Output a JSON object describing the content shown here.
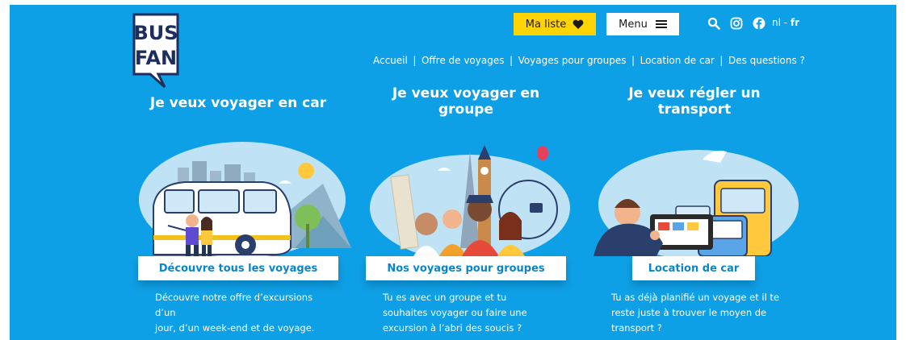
{
  "logo": {
    "line1": "BUS",
    "line2": "FAN"
  },
  "header": {
    "liste_label": "Ma liste",
    "menu_label": "Menu",
    "lang_nl": "nl",
    "lang_sep": " - ",
    "lang_fr": "fr"
  },
  "nav": {
    "items": [
      "Accueil",
      "Offre de voyages",
      "Voyages pour groupes",
      "Location de car",
      "Des questions ?"
    ],
    "separator": "|"
  },
  "columns": [
    {
      "title_lines": [
        "Je veux voyager en car"
      ],
      "button": "Découvre tous les voyages",
      "desc_lines": [
        "Découvre notre offre d’excursions d’un",
        "jour, d’un week-end et de voyage."
      ]
    },
    {
      "title_lines": [
        "Je veux voyager en",
        "groupe"
      ],
      "button": "Nos voyages pour groupes",
      "desc_lines": [
        "Tu es avec un groupe et tu",
        "souhaites voyager ou faire une",
        "excursion à l’abri des soucis ?"
      ]
    },
    {
      "title_lines": [
        "Je veux régler un",
        "transport"
      ],
      "button": "Location de car",
      "desc_lines": [
        "Tu as déjà planifié un voyage et il te",
        "reste juste à trouver le moyen de",
        "transport ?"
      ]
    }
  ],
  "colors": {
    "background": "#0ea0e6",
    "accent_yellow": "#ffd400",
    "button_text": "#0a86c8",
    "logo_navy": "#1d2d5e"
  },
  "icons": [
    "heart-icon",
    "hamburger-icon",
    "search-icon",
    "instagram-icon",
    "facebook-icon"
  ]
}
